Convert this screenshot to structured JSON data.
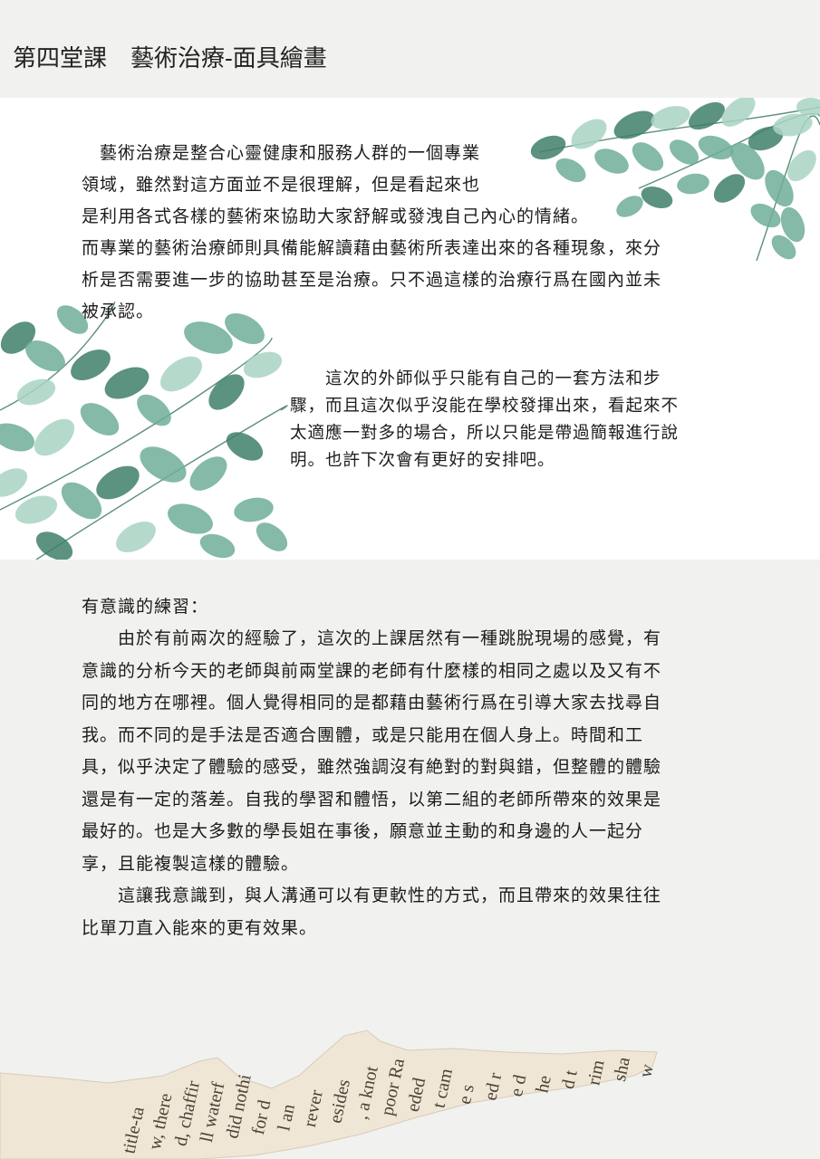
{
  "header": {
    "title": "第四堂課　藝術治療-面具繪畫"
  },
  "intro": {
    "lines": [
      "　藝術治療是整合心靈健康和服務人群的一個專業",
      "領域，雖然對這方面並不是很理解，但是看起來也",
      "是利用各式各樣的藝術來協助大家舒解或發洩自己內心的情緒。",
      "而專業的藝術治療師則具備能解讀藉由藝術所表達出來的各種現象，來分",
      "析是否需要進一步的協助甚至是治療。只不過這樣的治療行爲在國內並未",
      "被承認。"
    ]
  },
  "note": {
    "lines": [
      "　　這次的外師似乎只能有自己的一套方法和步",
      "驟，而且這次似乎沒能在學校發揮出來，看起來不",
      "太適應一對多的場合，所以只能是帶過簡報進行說",
      "明。也許下次會有更好的安排吧。"
    ]
  },
  "reflection": {
    "heading": "有意識的練習：",
    "lines": [
      "　　由於有前兩次的經驗了，這次的上課居然有一種跳脫現場的感覺，有",
      "意識的分析今天的老師與前兩堂課的老師有什麼樣的相同之處以及又有不",
      "同的地方在哪裡。個人覺得相同的是都藉由藝術行爲在引導大家去找尋自",
      "我。而不同的是手法是否適合團體，或是只能用在個人身上。時間和工",
      "具，似乎決定了體驗的感受，雖然強調沒有絶對的對與錯，但整體的體驗",
      "還是有一定的落差。自我的學習和體悟，以第二組的老師所帶來的效果是",
      "最好的。也是大多數的學長姐在事後，願意並主動的和身邊的人一起分",
      "享，且能複製這樣的體驗。",
      "　　這讓我意識到，與人溝通可以有更軟性的方式，而且帶來的效果往往",
      "比單刀直入能來的更有效果。"
    ]
  },
  "torn_paper": {
    "words": [
      "title-ta",
      "w, there",
      "d, chaffir",
      "ll waterf",
      "did nothi",
      "for d",
      "l an",
      "rever",
      "esides",
      ", a knot",
      "poor Ra",
      "eded",
      "t cam",
      "e s",
      "ed r",
      "e d",
      "he",
      "d t",
      "rim",
      "sha",
      "w"
    ]
  },
  "colors": {
    "background": "#f1f1ef",
    "band": "#ffffff",
    "leaf_dark": "#3f7f6a",
    "leaf_mid": "#6fae98",
    "leaf_light": "#a8d3c3",
    "paper": "#efe6d6"
  }
}
